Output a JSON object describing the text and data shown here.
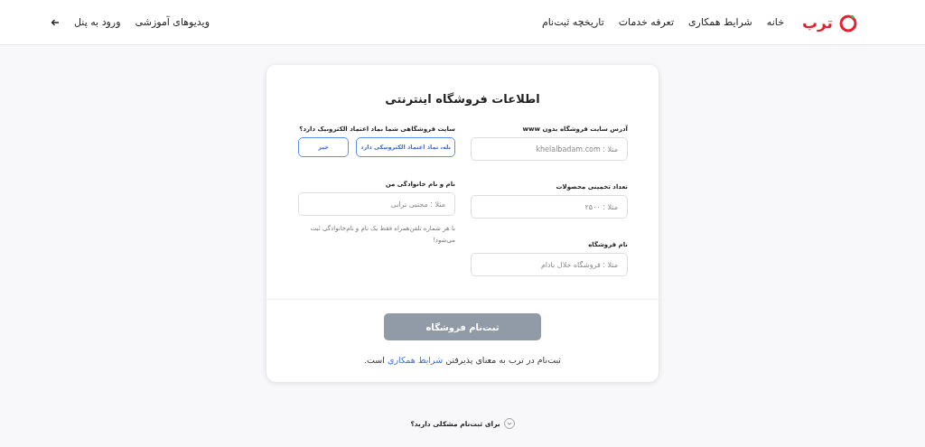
{
  "header": {
    "logo": "ترب",
    "nav": [
      "خانه",
      "شرایط همکاری",
      "تعرفه خدمات",
      "تاریخچه ثبت‌نام"
    ],
    "actions": [
      "ویدیوهای آموزشی",
      "ورود به پنل"
    ]
  },
  "form": {
    "title": "اطلاعات فروشگاه اینترنتی",
    "fields": [
      {
        "label": "آدرس سایت فروشگاه بدون www",
        "placeholder": "مثلا : khelalbadam.com"
      },
      {
        "label": "تعداد تخمینی محصولات",
        "placeholder": "مثلا : ۲۵۰۰"
      },
      {
        "label": "نام فروشگاه",
        "placeholder": "مثلا : فروشگاه خلال بادام"
      }
    ],
    "trust_question": {
      "label": "سایت فروشگاهی شما نماد اعتماد الکترونیک دارد؟",
      "options": [
        {
          "label": "بله، نماد اعتماد الکترونیکی دارد",
          "selected": false
        },
        {
          "label": "خیر",
          "selected": false
        }
      ]
    },
    "name_field": {
      "label": "نام و نام خانوادگی من",
      "placeholder": "مثلا : مجتبی ترابی",
      "hint": "با هر شماره تلفن‌همراه فقط یک نام و نام‌خانوادگی ثبت می‌شود!"
    },
    "submit": {
      "label": "ثبت‌نام فروشگاه",
      "disabled": true
    },
    "note": {
      "before": "ثبت‌نام در ترب به معنای پذیرفتن ",
      "link": "شرایط همکاری",
      "after": " است."
    }
  },
  "help": {
    "label": "برای ثبت‌نام مشکلی دارید؟"
  }
}
